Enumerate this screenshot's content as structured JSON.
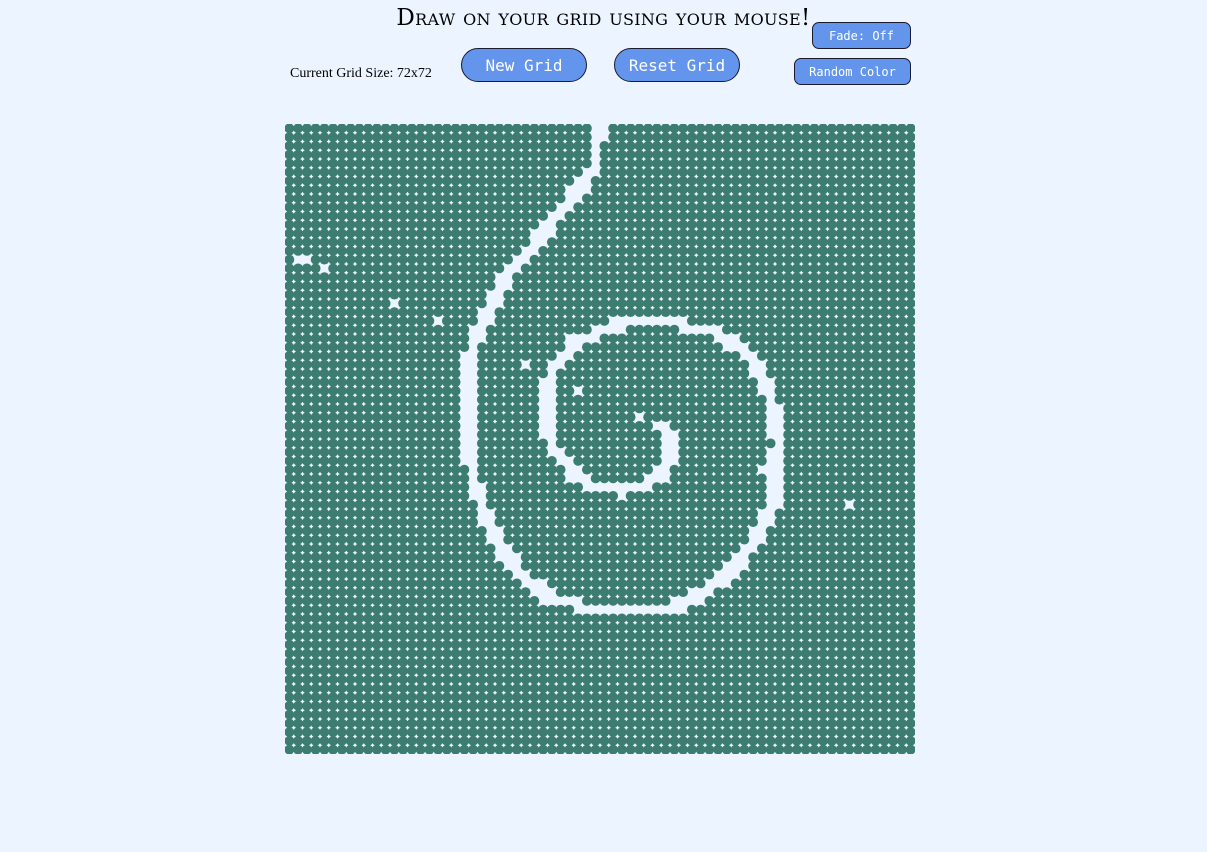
{
  "title": "Draw on your grid using your mouse!",
  "grid_size_text": "Current Grid Size: 72x72",
  "buttons": {
    "new_grid": "New Grid",
    "reset_grid": "Reset Grid",
    "fade": "Fade: Off",
    "random_color": "Random Color"
  },
  "grid": {
    "rows": 72,
    "cols": 72,
    "cell_color": "#3d7c71",
    "erased_color": "#ebf4ff"
  },
  "colors": {
    "background": "#ebf4ff",
    "button": "#6495ed",
    "button_text": "#ffffff"
  }
}
